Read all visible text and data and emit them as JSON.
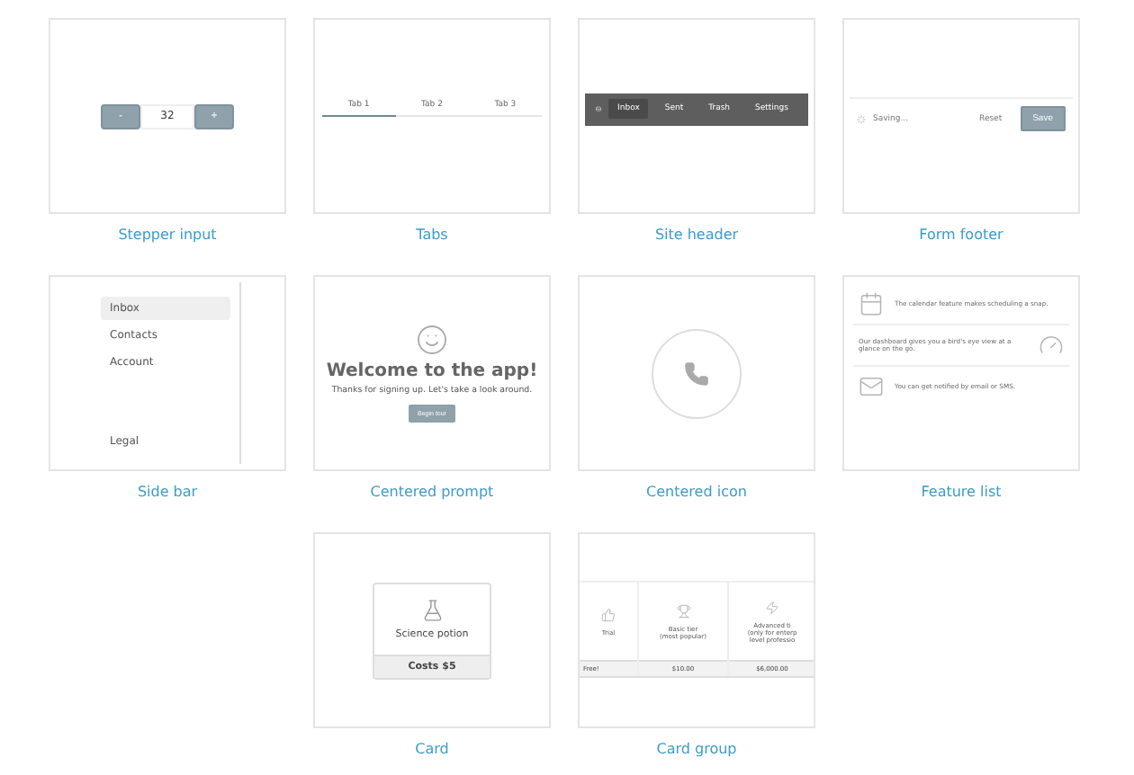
{
  "tiles": [
    {
      "kind": "stepper",
      "caption": "Stepper input",
      "minus": "-",
      "value": "32",
      "plus": "+"
    },
    {
      "kind": "tabs",
      "caption": "Tabs",
      "tabs": [
        {
          "label": "Tab 1",
          "selected": true
        },
        {
          "label": "Tab 2",
          "selected": false
        },
        {
          "label": "Tab 3",
          "selected": false
        }
      ]
    },
    {
      "kind": "header",
      "caption": "Site header",
      "items": [
        {
          "label": "Inbox",
          "selected": true
        },
        {
          "label": "Sent",
          "selected": false
        },
        {
          "label": "Trash",
          "selected": false
        }
      ],
      "settings": "Settings"
    },
    {
      "kind": "footer",
      "caption": "Form footer",
      "status": "Saving...",
      "reset": "Reset",
      "save": "Save"
    },
    {
      "kind": "sidebar",
      "caption": "Side bar",
      "items": [
        {
          "label": "Inbox",
          "selected": true
        },
        {
          "label": "Contacts",
          "selected": false
        },
        {
          "label": "Account",
          "selected": false
        }
      ],
      "bottom": "Legal"
    },
    {
      "kind": "prompt",
      "caption": "Centered prompt",
      "title": "Welcome to the app!",
      "text": "Thanks for signing up. Let's take a look around.",
      "button": "Begin tour"
    },
    {
      "kind": "icon",
      "caption": "Centered icon"
    },
    {
      "kind": "features",
      "caption": "Feature list",
      "features": [
        {
          "text": "The calendar feature makes scheduling a snap."
        },
        {
          "text": "Our dashboard gives you a bird's eye view at a glance on the go."
        },
        {
          "text": "You can get notified by email or SMS."
        }
      ]
    },
    {
      "kind": "card",
      "caption": "Card",
      "title": "Science potion",
      "price": "Costs $5"
    },
    {
      "kind": "cardgroup",
      "caption": "Card group",
      "cards": [
        {
          "lines": [
            "Trial"
          ],
          "price": "Free!"
        },
        {
          "lines": [
            "Basic tier",
            "(most popular)"
          ],
          "price": "$10.00"
        },
        {
          "lines": [
            "Advanced ti",
            "(only for enterp",
            "level professio"
          ],
          "price": "$6,000.00"
        }
      ]
    }
  ]
}
